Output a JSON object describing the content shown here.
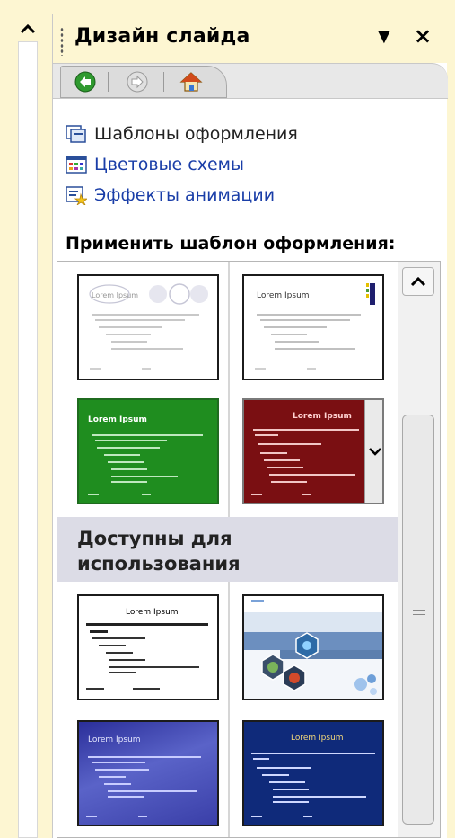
{
  "panel": {
    "title": "Дизайн слайда",
    "menu_glyph": "▼",
    "close_glyph": "×"
  },
  "nav": {
    "back_icon": "back-arrow-icon",
    "forward_icon": "forward-arrow-icon",
    "home_icon": "home-icon"
  },
  "links": [
    {
      "label": "Шаблоны оформления",
      "icon": "design-templates-icon"
    },
    {
      "label": "Цветовые схемы",
      "icon": "color-schemes-icon"
    },
    {
      "label": "Эффекты анимации",
      "icon": "animation-effects-icon"
    }
  ],
  "gallery": {
    "heading": "Применить шаблон оформления:",
    "available_label": "Доступны для использования",
    "thumbnail_title": "Lorem Ipsum",
    "colors": {
      "white": "#ffffff",
      "green": "#1f8d1f",
      "dark_red": "#7a0f12",
      "blue_gradient": "#3a3fa8",
      "navy": "#0f2a7a"
    }
  }
}
